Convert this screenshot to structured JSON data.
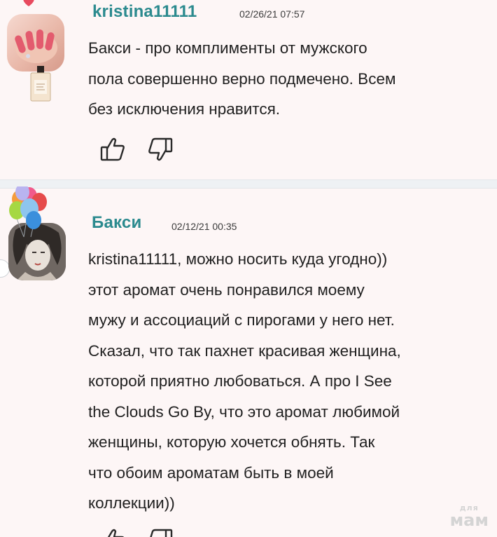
{
  "comments": [
    {
      "username": "kristina11111",
      "timestamp": "02/26/21 07:57",
      "lines": [
        "Бакси - про комплименты от мужского",
        "пола совершенно верно подмечено. Всем",
        "без исключения нравится."
      ],
      "like_icon": "thumbs-up-icon",
      "dislike_icon": "thumbs-down-icon"
    },
    {
      "username": "Бакси",
      "timestamp": "02/12/21 00:35",
      "lines": [
        "kristina11111, можно носить куда угодно))",
        "этот аромат очень понравился моему",
        "мужу и ассоциаций с пирогами у него нет.",
        "Сказал, что так пахнет красивая женщина,",
        "которой приятно любоваться. А про I See",
        "the Clouds Go By, что это аромат любимой",
        "женщины, которую хочется обнять. Так",
        "что обоим ароматам быть в моей",
        "коллекции))"
      ],
      "like_icon": "thumbs-up-icon",
      "dislike_icon": "thumbs-down-icon"
    }
  ],
  "watermark": {
    "small": "для",
    "big": "мам"
  },
  "colors": {
    "username": "#2b8a8e",
    "text": "#1f1f1f",
    "card_background": "#fdf6f6",
    "page_background": "#eef1f4"
  }
}
